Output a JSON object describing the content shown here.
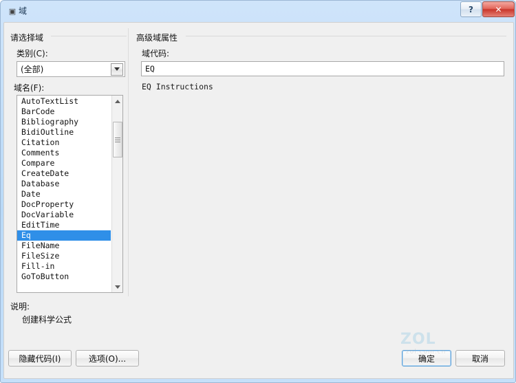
{
  "window": {
    "title": "域",
    "icon": "field-dialog-icon",
    "caption_buttons": {
      "help_label": "?",
      "close_label": "✕"
    }
  },
  "left_panel": {
    "group_title": "请选择域",
    "category_label": "类别(C):",
    "category_value": "(全部)",
    "category_options": [
      "(全部)"
    ],
    "fieldname_label": "域名(F):",
    "field_names": [
      "AutoTextList",
      "BarCode",
      "Bibliography",
      "BidiOutline",
      "Citation",
      "Comments",
      "Compare",
      "CreateDate",
      "Database",
      "Date",
      "DocProperty",
      "DocVariable",
      "EditTime",
      "Eq",
      "FileName",
      "FileSize",
      "Fill-in",
      "GoToButton"
    ],
    "selected_field": "Eq"
  },
  "right_panel": {
    "group_title": "高级域属性",
    "fieldcode_label": "域代码:",
    "fieldcode_value": "EQ",
    "instructions_text": "EQ Instructions"
  },
  "description": {
    "label": "说明:",
    "text": "创建科学公式"
  },
  "buttons": {
    "hide_codes": "隐藏代码(I)",
    "options": "选项(O)...",
    "ok": "确定",
    "cancel": "取消"
  },
  "watermark": {
    "main": "ZOL",
    "sub": "zol.com.cn"
  },
  "colors": {
    "titlebar": "#b9d9f7",
    "dialog_bg": "#f0f0f0",
    "selection": "#2f8fe8",
    "close_button": "#c9372c"
  }
}
